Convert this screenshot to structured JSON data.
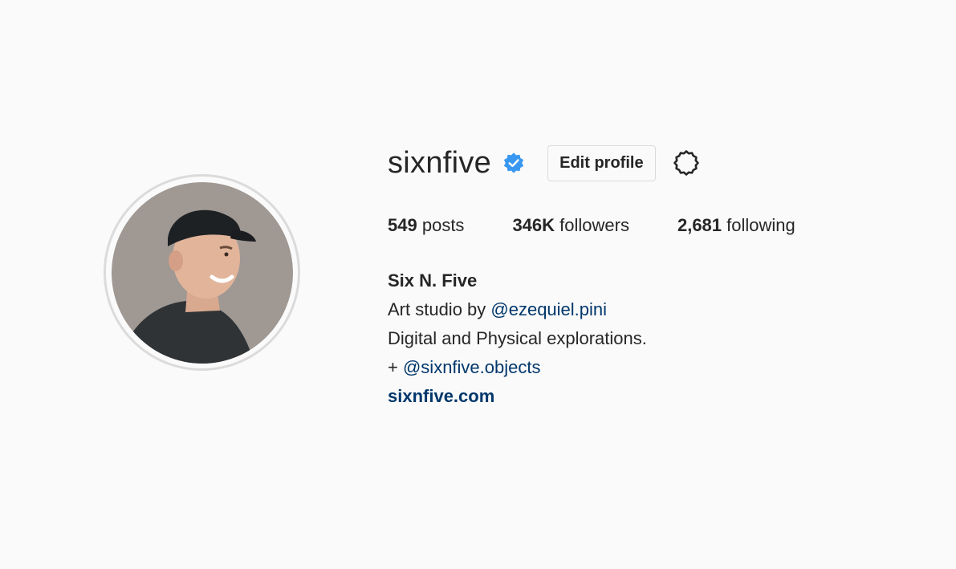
{
  "profile": {
    "username": "sixnfive",
    "verified": true,
    "edit_label": "Edit profile",
    "accent_color": "#3897f0",
    "link_color": "#00376b"
  },
  "stats": {
    "posts_count": "549",
    "posts_label": "posts",
    "followers_count": "346K",
    "followers_label": "followers",
    "following_count": "2,681",
    "following_label": "following"
  },
  "bio": {
    "full_name": "Six N. Five",
    "line1_prefix": "Art studio by ",
    "line1_mention": "@ezequiel.pini",
    "line2": "Digital and Physical explorations.",
    "line3_prefix": "+ ",
    "line3_mention": "@sixnfive.objects",
    "website": "sixnfive.com"
  },
  "icons": {
    "verified": "verified-badge-icon",
    "settings": "gear-icon"
  }
}
